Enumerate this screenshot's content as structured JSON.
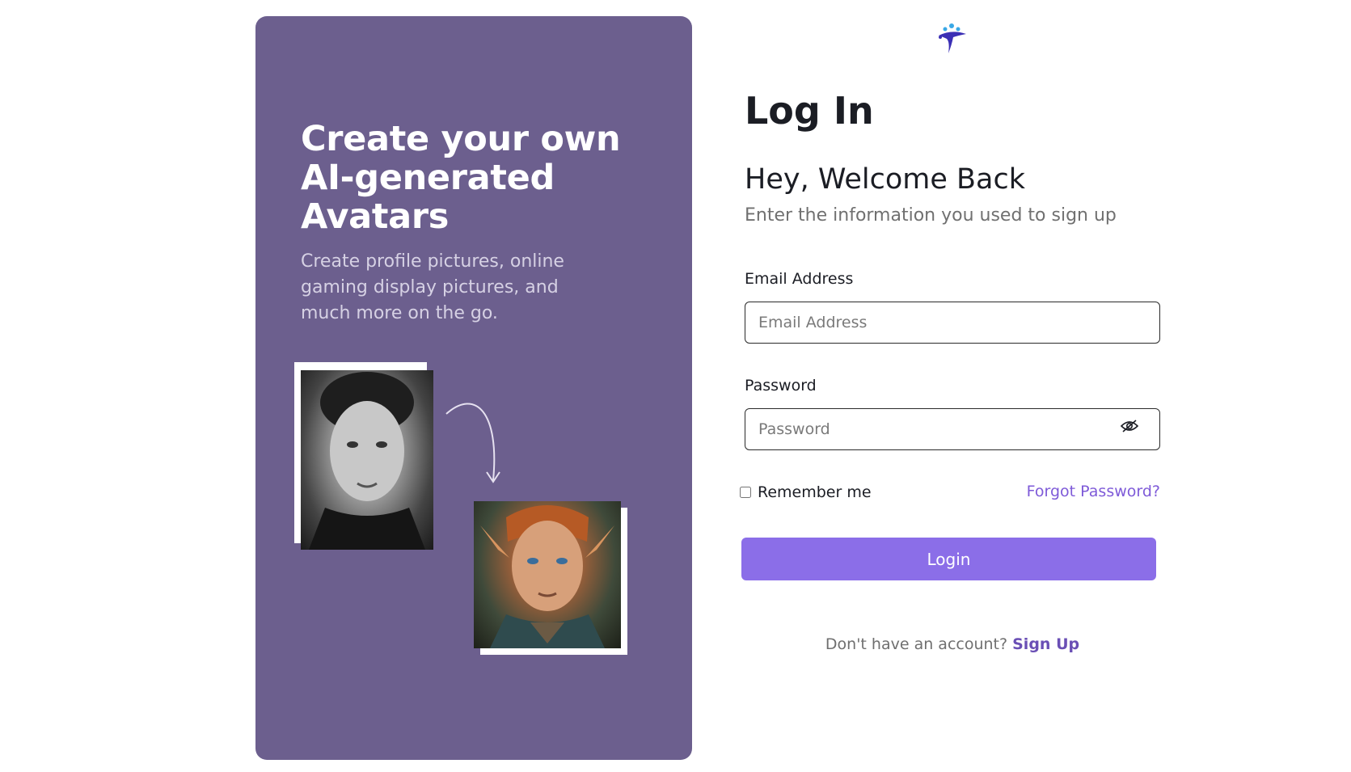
{
  "promo": {
    "title": "Create your own AI-generated Avatars",
    "subtitle": "Create profile pictures, online gaming display pictures, and much more on the go."
  },
  "form": {
    "heading": "Log In",
    "welcome": "Hey, Welcome Back",
    "welcome_sub": "Enter the information you used to sign up",
    "email": {
      "label": "Email Address",
      "placeholder": "Email Address",
      "value": ""
    },
    "password": {
      "label": "Password",
      "placeholder": "Password",
      "value": ""
    },
    "remember_label": "Remember me",
    "forgot_label": "Forgot Password?",
    "login_label": "Login",
    "no_account_text": "Don't have an account? ",
    "signup_label": "Sign Up"
  },
  "colors": {
    "panel": "#6c5f8e",
    "accent": "#8b6ee8",
    "link": "#7e5ad8"
  },
  "icons": {
    "logo": "brand-logo-icon",
    "password_toggle": "eye-slash-icon",
    "arrow": "curved-arrow-icon"
  }
}
